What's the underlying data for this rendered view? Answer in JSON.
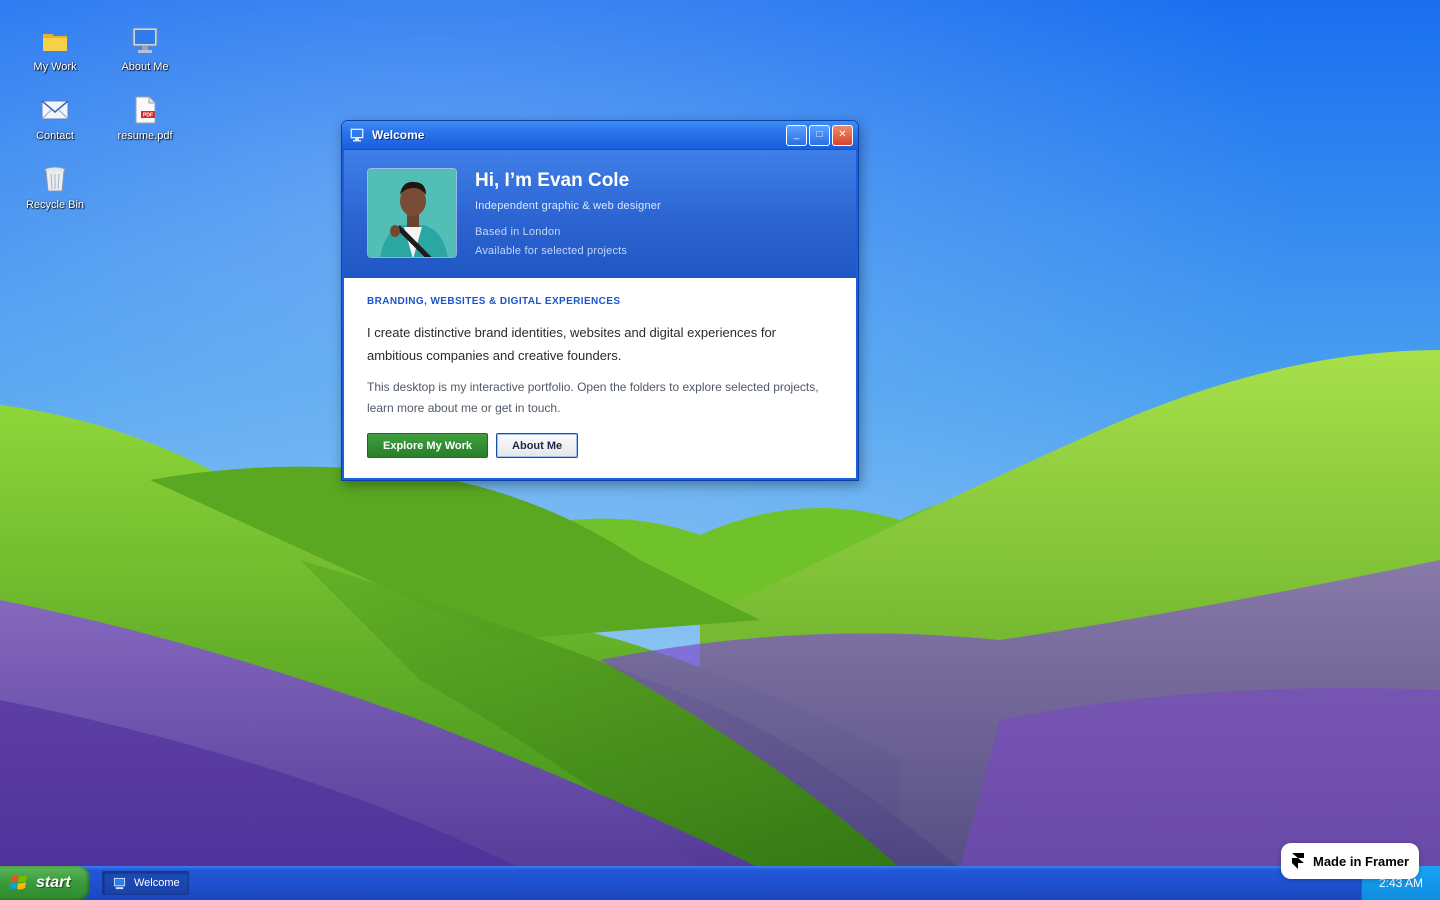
{
  "desktop": {
    "icons": [
      {
        "label": "My Work",
        "icon": "folder-icon"
      },
      {
        "label": "About Me",
        "icon": "computer-icon"
      },
      {
        "label": "Contact",
        "icon": "mail-icon"
      },
      {
        "label": "resume.pdf",
        "icon": "pdf-file-icon"
      },
      {
        "label": "Recycle Bin",
        "icon": "recycle-bin-icon"
      }
    ]
  },
  "window": {
    "title": "Welcome",
    "controls": {
      "minimize": "_",
      "maximize": "□",
      "close": "✕"
    },
    "hero": {
      "name": "Hi, I’m Evan Cole",
      "role": "Independent graphic & web designer",
      "location": "Based in London",
      "availability": "Available for selected projects"
    },
    "content": {
      "tagline": "BRANDING, WEBSITES & DIGITAL EXPERIENCES",
      "lead": "I create distinctive brand identities, websites and digital experiences for ambitious companies and creative founders.",
      "description": "This desktop is my interactive portfolio. Open the folders to explore selected projects, learn more about me or get in touch."
    },
    "actions": {
      "primary": "Explore My Work",
      "secondary": "About Me"
    }
  },
  "taskbar": {
    "start_label": "start",
    "tasks": [
      {
        "label": "Welcome"
      }
    ],
    "clock": "2:43 AM"
  },
  "badge": {
    "label": "Made in Framer"
  },
  "colors": {
    "accent": "#1d55c7",
    "primary_button": "#2e8a2e",
    "taskbar": "#1e4fcc",
    "tray": "#0e8ee0"
  }
}
